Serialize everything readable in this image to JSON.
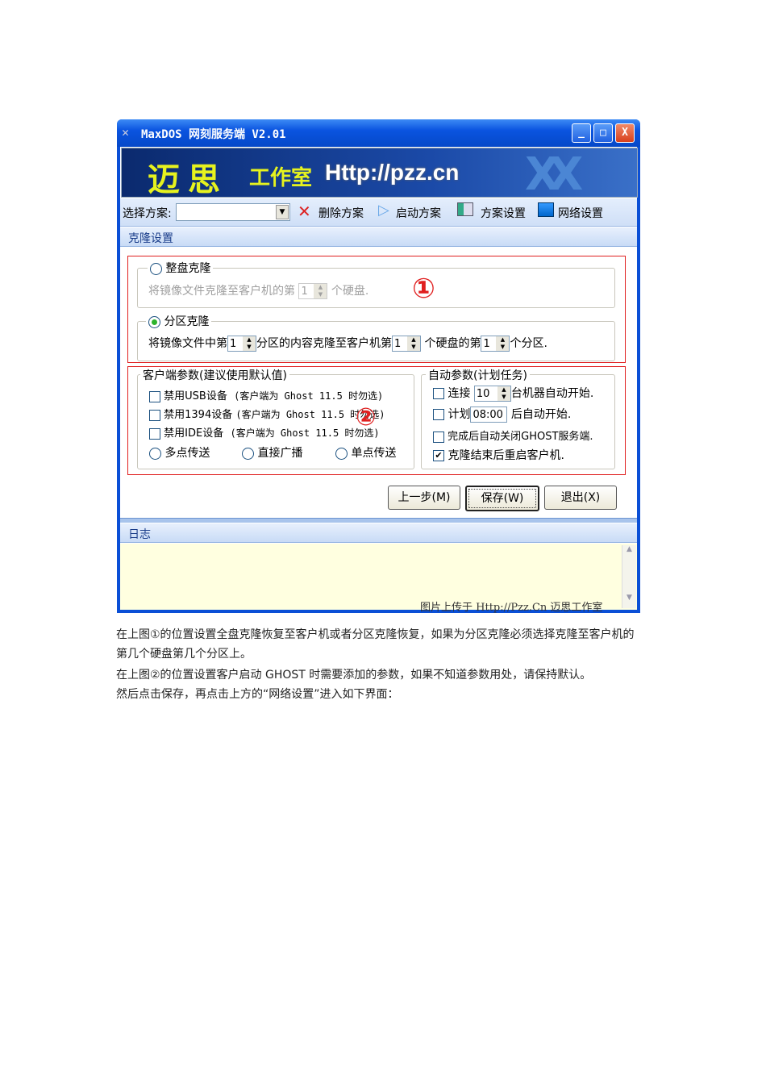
{
  "window": {
    "title": "MaxDOS 网刻服务端 V2.01",
    "min": "_",
    "max": "□",
    "close": "X"
  },
  "banner": {
    "name": "迈思",
    "studio": "工作室",
    "url": "Http://pzz.cn",
    "logo": "XX"
  },
  "toolbar": {
    "select_label": "选择方案:",
    "select_value": "",
    "delete": "删除方案",
    "start": "启动方案",
    "scheme_settings": "方案设置",
    "network_settings": "网络设置"
  },
  "clone": {
    "header": "克隆设置",
    "whole_disk": {
      "label": "整盘克隆",
      "selected": false,
      "text1": "将镜像文件克隆至客户机的第",
      "disk": "1",
      "text2": "个硬盘."
    },
    "partition": {
      "label": "分区克隆",
      "selected": true,
      "text1": "将镜像文件中第",
      "src_part": "1",
      "text2": "分区的内容克隆至客户机第",
      "disk": "1",
      "text3": "个硬盘的第",
      "dst_part": "1",
      "text4": "个分区."
    },
    "marker1": "①",
    "marker2": "②"
  },
  "client_params": {
    "legend": "客户端参数(建议使用默认值)",
    "options": [
      {
        "label": "禁用USB设备",
        "note": "(客户端为 Ghost 11.5 时勿选)",
        "checked": false
      },
      {
        "label": "禁用1394设备",
        "note": "(客户端为 Ghost 11.5 时勿选)",
        "checked": false
      },
      {
        "label": "禁用IDE设备",
        "note": "(客户端为 Ghost 11.5 时勿选)",
        "checked": false
      }
    ],
    "modes": [
      "多点传送",
      "直接广播",
      "单点传送"
    ]
  },
  "auto_params": {
    "legend": "自动参数(计划任务)",
    "connect": {
      "pre": "连接",
      "value": "10",
      "post": "台机器自动开始.",
      "checked": false
    },
    "plan": {
      "pre": "计划",
      "value": "08:00",
      "post": "后自动开始.",
      "checked": false
    },
    "close_server": {
      "label": "完成后自动关闭GHOST服务端.",
      "checked": false
    },
    "reboot": {
      "label": "克隆结束后重启客户机.",
      "checked": true
    }
  },
  "buttons": {
    "prev": "上一步(M)",
    "save": "保存(W)",
    "exit": "退出(X)"
  },
  "log": {
    "header": "日志",
    "watermark": "图片上传于 Http://Pzz.Cn 迈思工作室"
  },
  "paragraphs": [
    "在上图①的位置设置全盘克隆恢复至客户机或者分区克隆恢复，如果为分区克隆必须选择克隆至客户机的",
    "第几个硬盘第几个分区上。",
    "在上图②的位置设置客户启动 GHOST 时需要添加的参数，如果不知道参数用处，请保持默认。",
    "然后点击保存，再点击上方的“网络设置”进入如下界面："
  ]
}
